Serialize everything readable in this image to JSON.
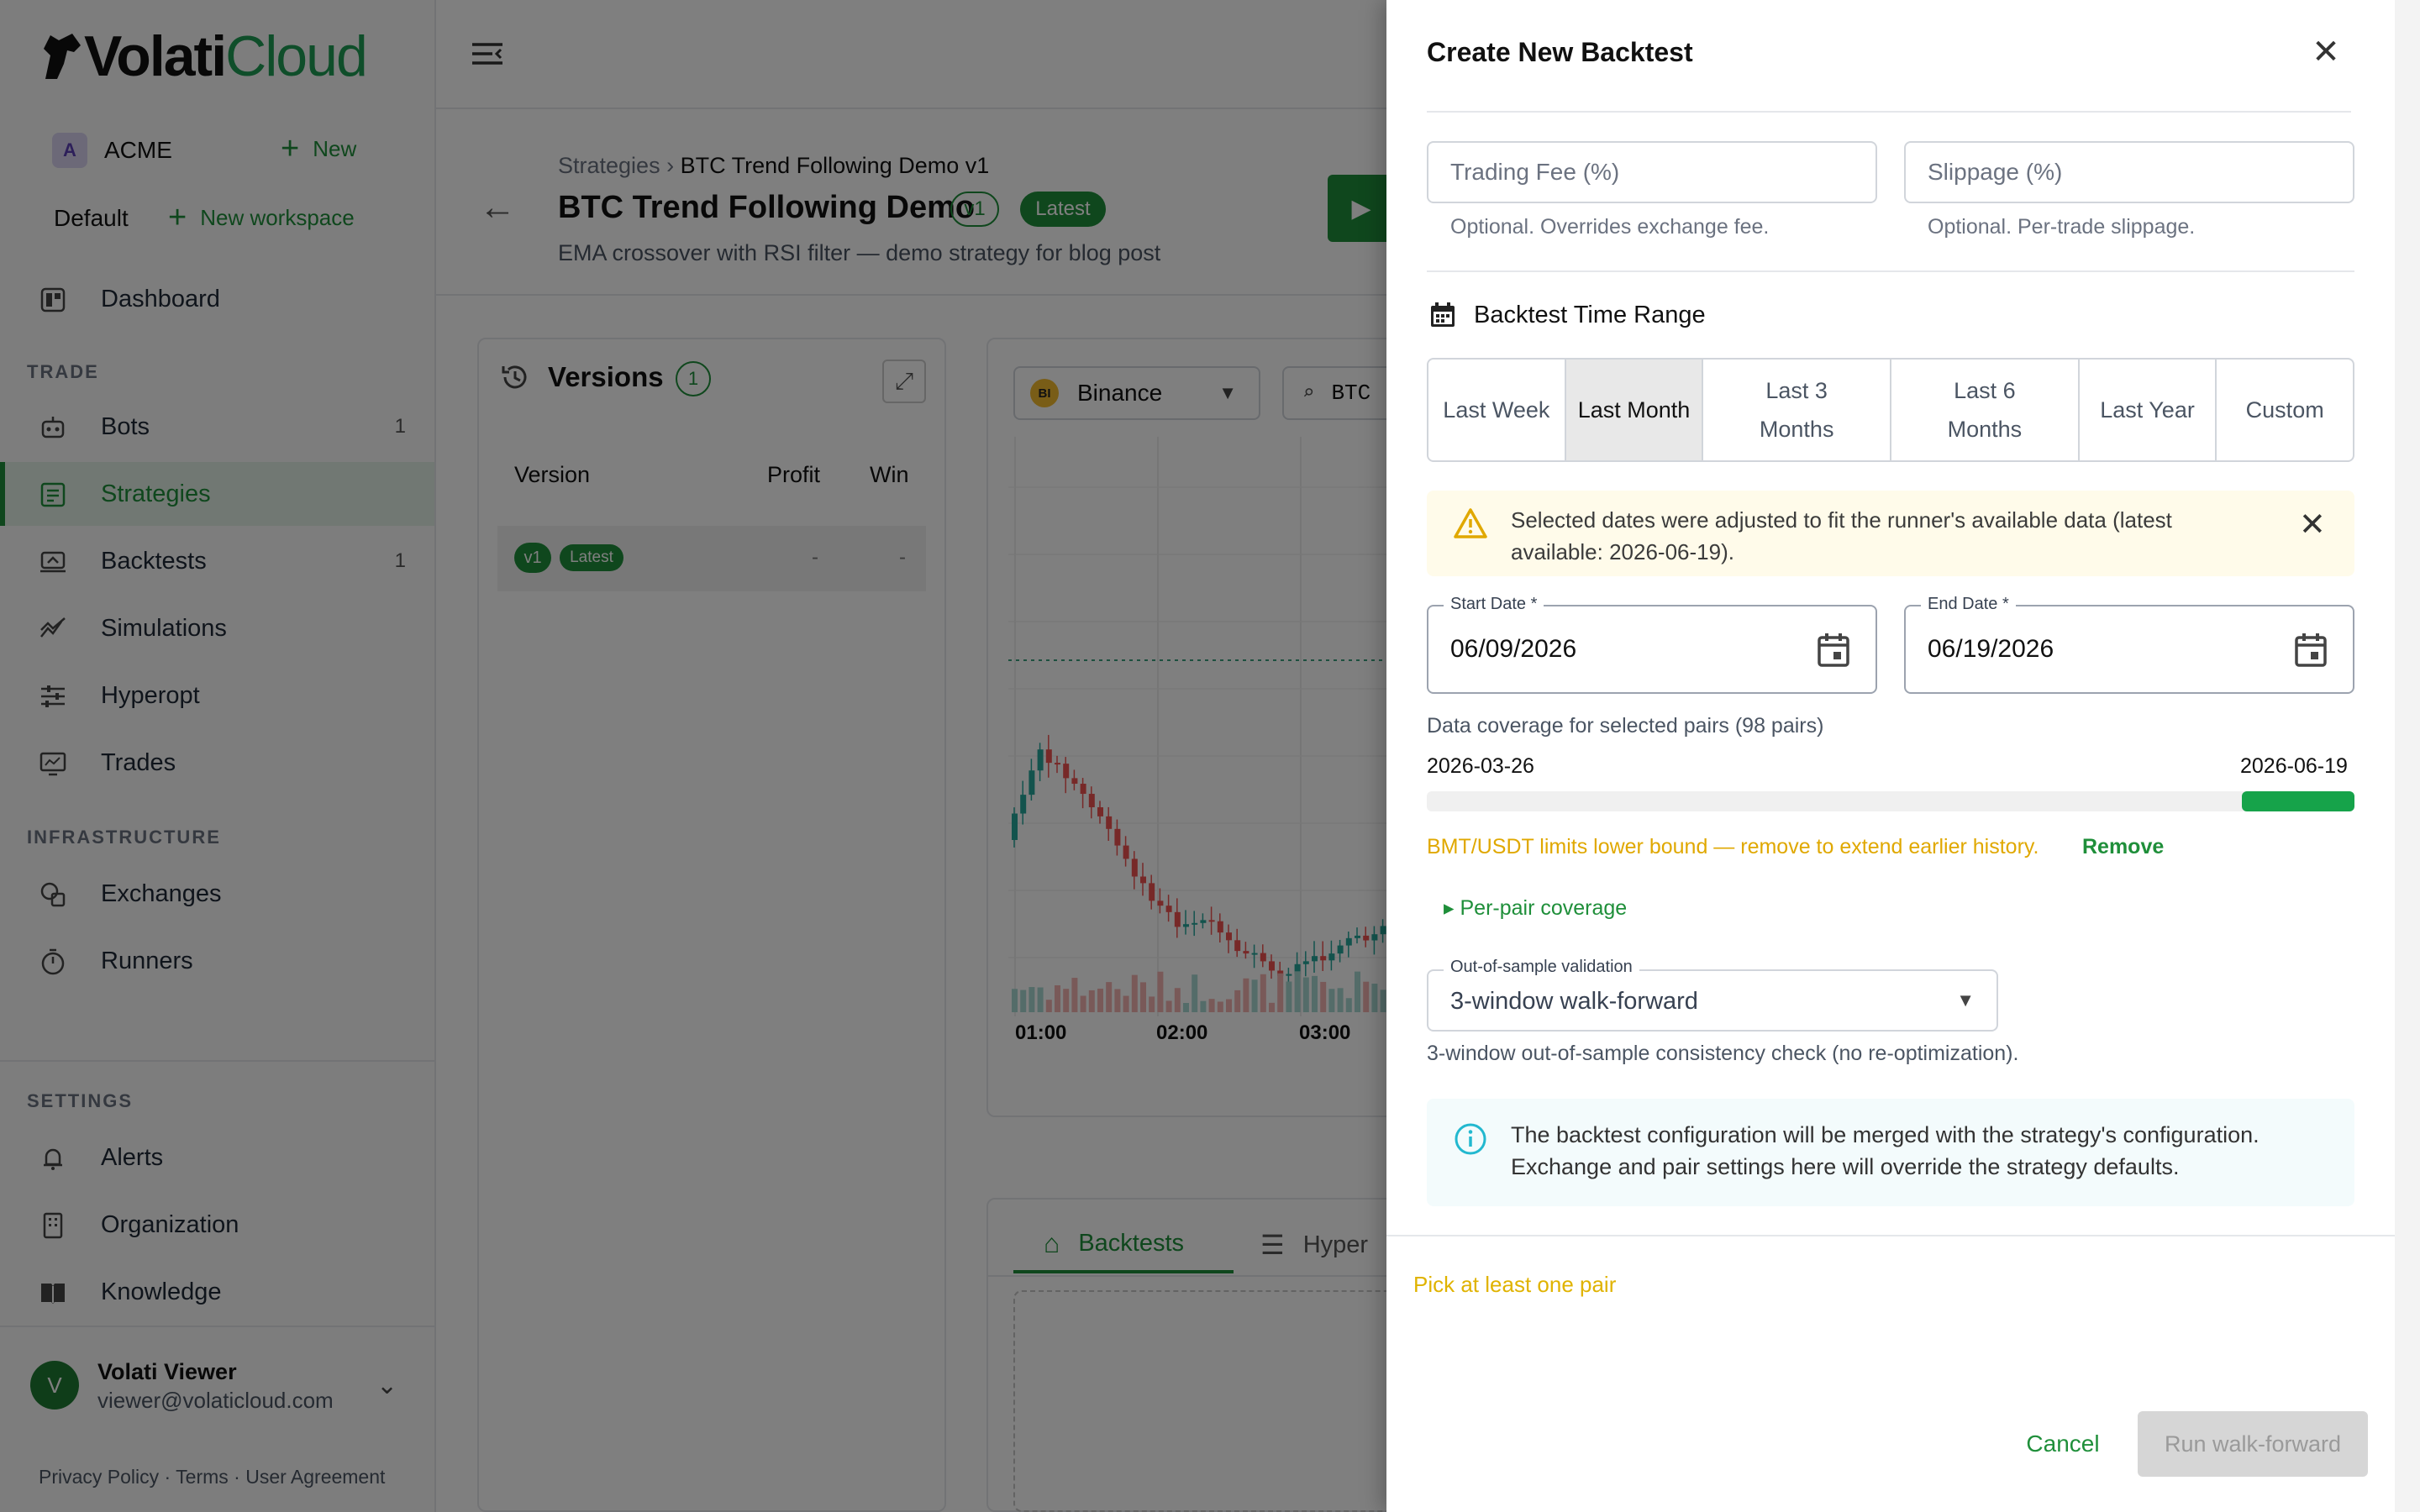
{
  "app": {
    "logo_text_a": "Volati",
    "logo_text_b": "Cloud"
  },
  "org": {
    "initial": "A",
    "name": "ACME",
    "new_label": "New"
  },
  "workspace": {
    "name": "Default",
    "new_label": "New workspace"
  },
  "sidebar": {
    "dashboard": "Dashboard",
    "trade_section": "TRADE",
    "items_trade": [
      {
        "label": "Bots",
        "count": "1"
      },
      {
        "label": "Strategies",
        "count": ""
      },
      {
        "label": "Backtests",
        "count": "1"
      },
      {
        "label": "Simulations",
        "count": ""
      },
      {
        "label": "Hyperopt",
        "count": ""
      },
      {
        "label": "Trades",
        "count": ""
      }
    ],
    "infra_section": "INFRASTRUCTURE",
    "items_infra": [
      {
        "label": "Exchanges"
      },
      {
        "label": "Runners"
      }
    ],
    "settings_section": "SETTINGS",
    "items_settings": [
      {
        "label": "Alerts"
      },
      {
        "label": "Organization"
      },
      {
        "label": "Knowledge"
      }
    ]
  },
  "user": {
    "initial": "V",
    "name": "Volati Viewer",
    "email": "viewer@volaticloud.com"
  },
  "legal": "Privacy Policy · Terms · User Agreement",
  "strategy": {
    "crumb_root": "Strategies",
    "crumb_sep": "›",
    "crumb_current": "BTC Trend Following Demo v1",
    "title": "BTC Trend Following Demo",
    "version_pill": "v1",
    "latest_pill": "Latest",
    "description": "EMA crossover with RSI filter — demo strategy for blog post"
  },
  "versions": {
    "title": "Versions",
    "count": "1",
    "col_version": "Version",
    "col_profit": "Profit",
    "col_win": "Win",
    "row": {
      "badge": "v1",
      "latest": "Latest",
      "profit": "-",
      "win": "-"
    }
  },
  "chart_panel": {
    "exchange": "Binance",
    "exchange_badge": "BI",
    "pair": "BTC",
    "x_ticks": [
      "01:00",
      "02:00",
      "03:00"
    ]
  },
  "bottom_tabs": {
    "backtests": "Backtests",
    "hyperopt": "Hyper"
  },
  "drawer": {
    "title": "Create New Backtest",
    "trading_fee_label": "Trading Fee (%)",
    "trading_fee_help": "Optional. Overrides exchange fee.",
    "slippage_label": "Slippage (%)",
    "slippage_help": "Optional. Per-trade slippage.",
    "time_range_heading": "Backtest Time Range",
    "range_options": [
      {
        "label": "Last Week",
        "selected": false
      },
      {
        "label": "Last Month",
        "selected": true
      },
      {
        "label": "Last 3 Months",
        "selected": false
      },
      {
        "label": "Last 6 Months",
        "selected": false
      },
      {
        "label": "Last Year",
        "selected": false
      },
      {
        "label": "Custom",
        "selected": false
      }
    ],
    "warning": "Selected dates were adjusted to fit the runner's available data (latest available: 2026-06-19).",
    "start_date_label": "Start Date *",
    "start_date_value": "06/09/2026",
    "end_date_label": "End Date *",
    "end_date_value": "06/19/2026",
    "coverage_label": "Data coverage for selected pairs (98 pairs)",
    "coverage_start": "2026-03-26",
    "coverage_end": "2026-06-19",
    "limit_text": "BMT/USDT limits lower bound — remove to extend earlier history.",
    "remove_label": "Remove",
    "per_pair_label": "▸ Per-pair coverage",
    "oos_label": "Out-of-sample validation",
    "oos_value": "3-window walk-forward",
    "oos_help": "3-window out-of-sample consistency check (no re-optimization).",
    "info": "The backtest configuration will be merged with the strategy's configuration. Exchange and pair settings here will override the strategy defaults.",
    "pick_pair": "Pick at least one pair",
    "cancel_label": "Cancel",
    "run_label": "Run walk-forward"
  },
  "colors": {
    "brand_green": "#1f8f3a",
    "warning_amber": "#e0a800",
    "info_cyan": "#22b8cf"
  }
}
